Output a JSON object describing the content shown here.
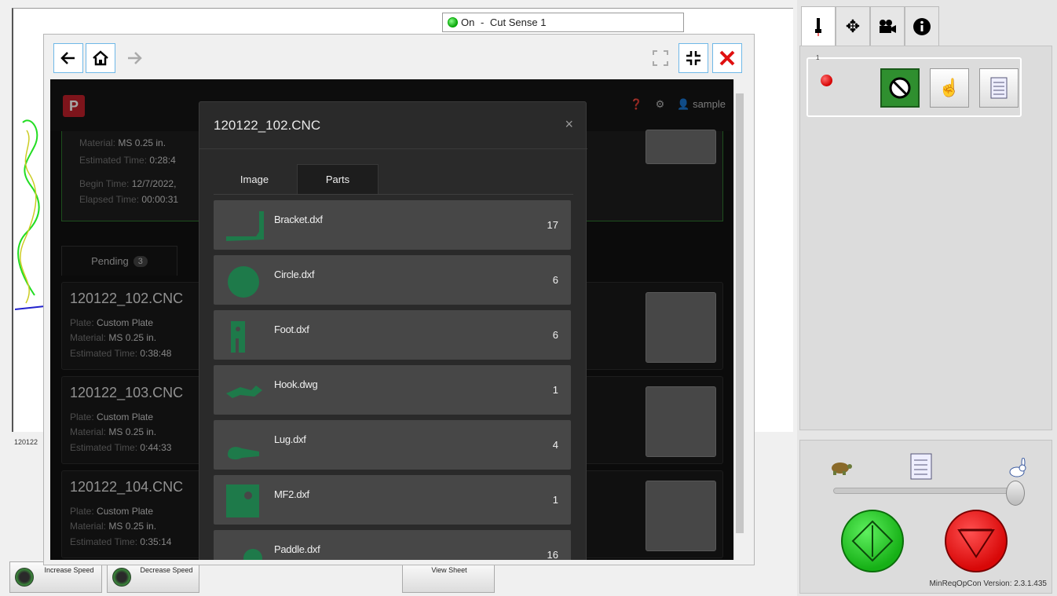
{
  "cut_sense": {
    "status": "On",
    "label": "Cut Sense 1"
  },
  "left_label": "120122",
  "bottom_buttons": {
    "increase_speed": "Increase Speed",
    "decrease_speed": "Decrease Speed",
    "view_sheet": "View Sheet"
  },
  "right_panel": {
    "tabs": [
      "torch-icon",
      "move-icon",
      "camera-icon",
      "info-icon"
    ],
    "version": "MinReqOpCon Version: 2.3.1.435",
    "indicator_color": "#d40000",
    "start_color": "#22c922",
    "stop_color": "#e01010"
  },
  "webapp": {
    "user": "sample",
    "active_job": {
      "material_label": "Material:",
      "material": "MS 0.25 in.",
      "est_label": "Estimated Time:",
      "est": "0:28:4",
      "begin_label": "Begin Time:",
      "begin": "12/7/2022,",
      "elapsed_label": "Elapsed Time:",
      "elapsed": "00:00:31"
    },
    "pending_label": "Pending",
    "pending_count": "3",
    "jobs": [
      {
        "title": "120122_102.CNC",
        "plate_label": "Plate:",
        "plate": "Custom Plate",
        "material_label": "Material:",
        "material": "MS 0.25 in.",
        "est_label": "Estimated Time:",
        "est": "0:38:48"
      },
      {
        "title": "120122_103.CNC",
        "plate_label": "Plate:",
        "plate": "Custom Plate",
        "material_label": "Material:",
        "material": "MS 0.25 in.",
        "est_label": "Estimated Time:",
        "est": "0:44:33"
      },
      {
        "title": "120122_104.CNC",
        "plate_label": "Plate:",
        "plate": "Custom Plate",
        "material_label": "Material:",
        "material": "MS 0.25 in.",
        "est_label": "Estimated Time:",
        "est": "0:35:14"
      }
    ]
  },
  "modal": {
    "title": "120122_102.CNC",
    "close": "×",
    "tabs": [
      "Image",
      "Parts"
    ],
    "active_tab": "Parts",
    "parts": [
      {
        "name": "Bracket.dxf",
        "count": "17"
      },
      {
        "name": "Circle.dxf",
        "count": "6"
      },
      {
        "name": "Foot.dxf",
        "count": "6"
      },
      {
        "name": "Hook.dwg",
        "count": "1"
      },
      {
        "name": "Lug.dxf",
        "count": "4"
      },
      {
        "name": "MF2.dxf",
        "count": "1"
      },
      {
        "name": "Paddle.dxf",
        "count": "16"
      }
    ],
    "part_color": "#1e7a4a"
  }
}
